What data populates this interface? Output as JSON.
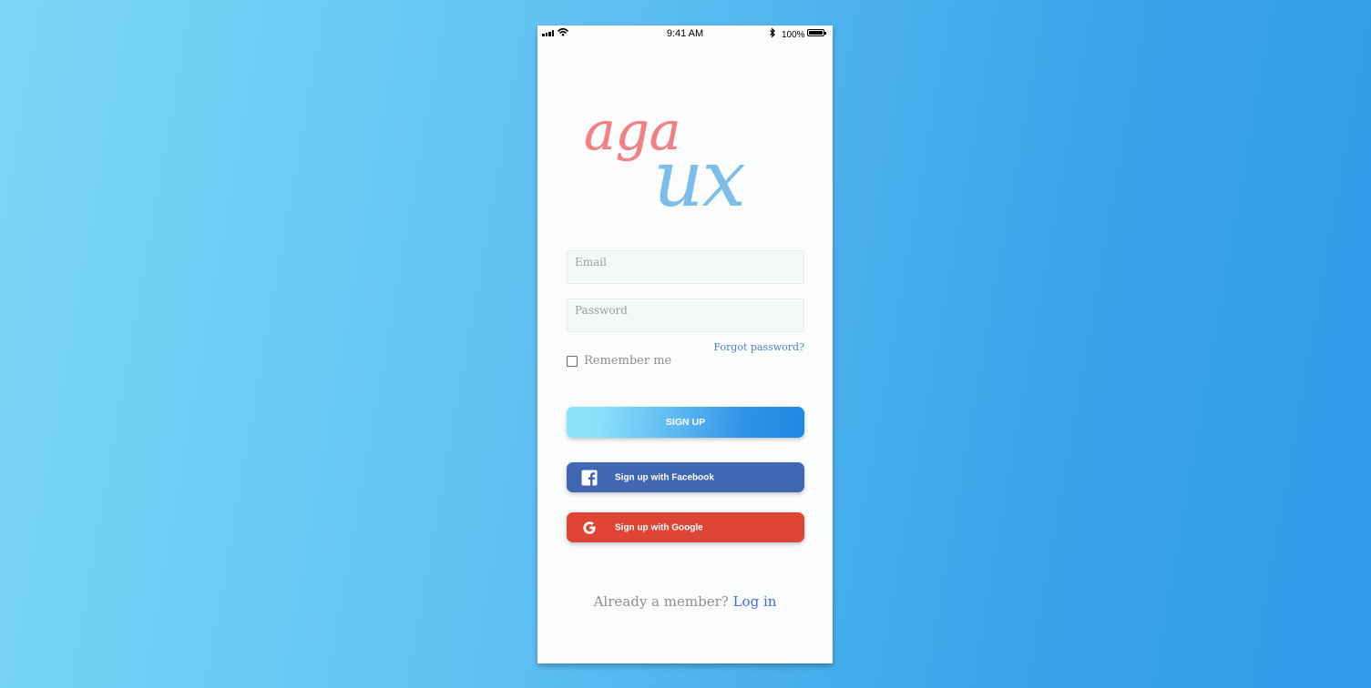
{
  "status_bar": {
    "time": "9:41 AM",
    "battery_percent": "100%"
  },
  "logo": {
    "text_top": "aga",
    "text_bottom": "ux",
    "color_top": "#f07f86",
    "color_bottom": "#7dbde9"
  },
  "form": {
    "email_placeholder": "Email",
    "password_placeholder": "Password",
    "forgot_password": "Forgot password?",
    "remember_me": "Remember me"
  },
  "buttons": {
    "sign_up": "SIGN UP",
    "facebook": "Sign up with Facebook",
    "google": "Sign up with Google"
  },
  "footer": {
    "prompt": "Already a member?",
    "login": "Log in"
  },
  "colors": {
    "facebook": "#4267b2",
    "google": "#de4536",
    "link": "#3d6ed6"
  },
  "icons": [
    "signal-icon",
    "wifi-icon",
    "bluetooth-icon",
    "battery-icon",
    "checkbox-icon",
    "facebook-icon",
    "google-icon"
  ]
}
